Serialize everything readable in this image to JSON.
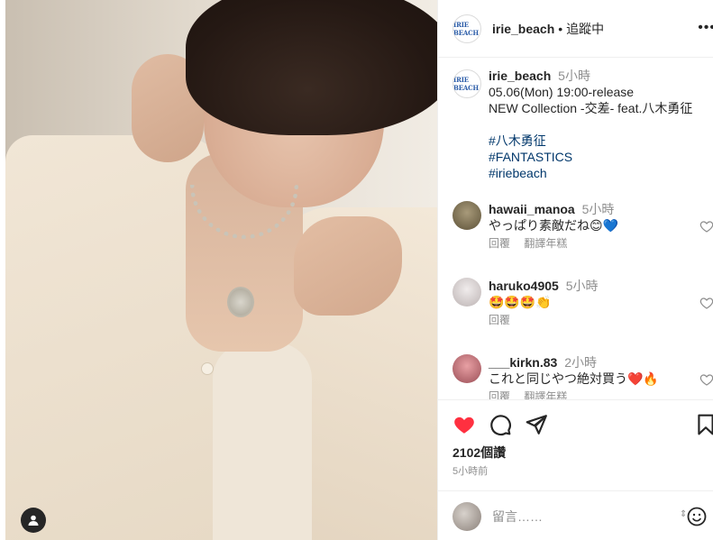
{
  "post": {
    "tag_icon": "person-tag-icon"
  },
  "header": {
    "username": "irie_beach",
    "separator": "•",
    "follow_status": "追蹤中",
    "avatar_text": "IRIE BEACH",
    "more_icon": "more-horizontal-icon"
  },
  "caption": {
    "username": "irie_beach",
    "time": "5小時",
    "lines": [
      "05.06(Mon) 19:00-release",
      "NEW Collection -交差- feat.八木勇征"
    ],
    "hashtags": [
      "#八木勇征",
      "#FANTASTICS",
      "#iriebeach"
    ]
  },
  "comments": [
    {
      "username": "hawaii_manoa",
      "time": "5小時",
      "text": "やっぱり素敵だね😊💙",
      "reply": "回覆",
      "translate": "翻譯年糕"
    },
    {
      "username": "haruko4905",
      "time": "5小時",
      "text": "🤩🤩🤩👏",
      "reply": "回覆",
      "translate": ""
    },
    {
      "username": "___kirkn.83",
      "time": "2小時",
      "text": "これと同じやつ絶対買う❤️🔥",
      "reply": "回覆",
      "translate": "翻譯年糕"
    }
  ],
  "actions": {
    "like_icon": "heart-filled-icon",
    "comment_icon": "comment-icon",
    "share_icon": "send-icon",
    "save_icon": "bookmark-icon",
    "likes": "2102個讚",
    "posted_ago": "5小時前"
  },
  "comment_box": {
    "placeholder": "留言……",
    "emoji_icon": "emoji-icon"
  },
  "colors": {
    "like_red": "#ff3040",
    "link_blue": "#00376b",
    "muted": "#8e8e8e"
  }
}
